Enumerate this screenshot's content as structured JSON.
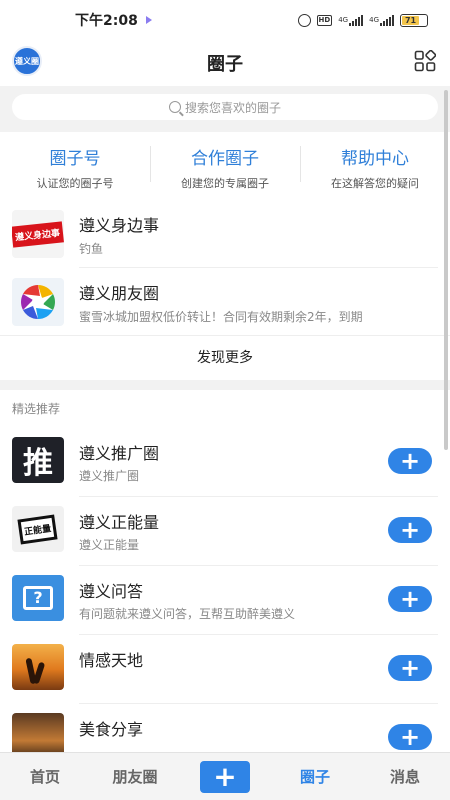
{
  "status_bar": {
    "time": "下午2:08",
    "hd": "HD",
    "net1": "4G",
    "net2": "4G",
    "battery": "71"
  },
  "header": {
    "logo_text": "遵义圈",
    "title": "圈子"
  },
  "search": {
    "placeholder": "搜索您喜欢的圈子"
  },
  "quick_links": [
    {
      "title": "圈子号",
      "subtitle": "认证您的圈子号"
    },
    {
      "title": "合作圈子",
      "subtitle": "创建您的专属圈子"
    },
    {
      "title": "帮助中心",
      "subtitle": "在这解答您的疑问"
    }
  ],
  "my_circles": [
    {
      "name": "遵义身边事",
      "desc": "钓鱼",
      "thumb_text": "遵义身边事"
    },
    {
      "name": "遵义朋友圈",
      "desc": "蜜雪冰城加盟权低价转让！合同有效期剩余2年，到期"
    }
  ],
  "discover_more": "发现更多",
  "section_label": "精选推荐",
  "recommended": [
    {
      "name": "遵义推广圈",
      "desc": "遵义推广圈",
      "thumb_text": "推"
    },
    {
      "name": "遵义正能量",
      "desc": "遵义正能量",
      "thumb_text": "正能量"
    },
    {
      "name": "遵义问答",
      "desc": "有问题就来遵义问答，互帮互助醉美遵义",
      "thumb_text": "?"
    },
    {
      "name": "情感天地",
      "desc": ""
    },
    {
      "name": "美食分享",
      "desc": ""
    }
  ],
  "add_symbol": "+",
  "tabbar": [
    {
      "label": "首页"
    },
    {
      "label": "朋友圈"
    },
    {
      "label": "+"
    },
    {
      "label": "圈子"
    },
    {
      "label": "消息"
    }
  ],
  "colors": {
    "accent": "#2f84e6",
    "link_blue": "#2f7fd8",
    "battery": "#f3c54b"
  }
}
